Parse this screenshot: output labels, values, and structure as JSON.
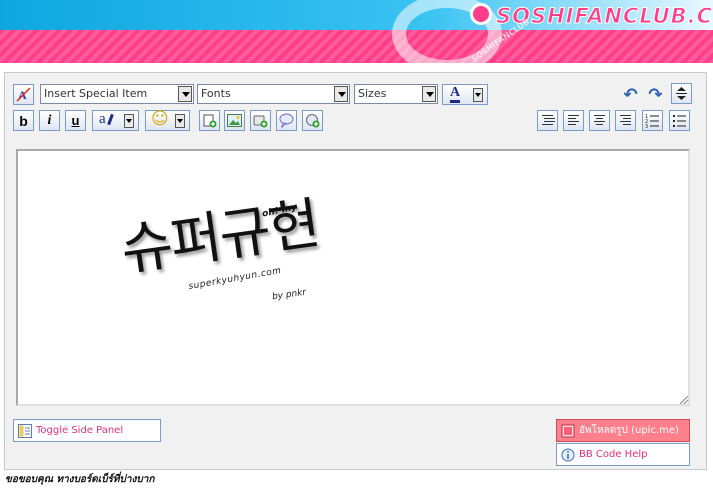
{
  "header": {
    "site_logo": "SOSHIFANCLUB.COM",
    "logo_sub": "SOSHIFANCLUB"
  },
  "toolbar": {
    "special_item": {
      "selected": "Insert Special Item"
    },
    "fonts": {
      "selected": "Fonts"
    },
    "sizes": {
      "selected": "Sizes"
    },
    "text_color_glyph": "A",
    "bold_glyph": "b",
    "italic_glyph": "i",
    "underline_glyph": "u",
    "highlight_glyph": "a",
    "smiley_glyph": "☺",
    "undo_glyph": "↶",
    "redo_glyph": "↷"
  },
  "editor": {
    "image_text": "슈퍼규현",
    "image_ohmy": "oh! my",
    "image_url": "superkyuhyun.com",
    "image_by": "by pnkr"
  },
  "buttons": {
    "toggle_side_panel": "Toggle Side Panel",
    "upload_image": "อัพโหลดรูป (upic.me)",
    "bb_code_help": "BB Code Help"
  },
  "footer": {
    "note": "ขอขอบคุณ ทางบอร์ดเบ็ร์ที่บ่างบาก"
  },
  "colors": {
    "banner_blue": "#1fb7ea",
    "banner_pink": "#ff3d88",
    "upload_button": "#ff7f8c",
    "link_pink": "#e0317a"
  }
}
